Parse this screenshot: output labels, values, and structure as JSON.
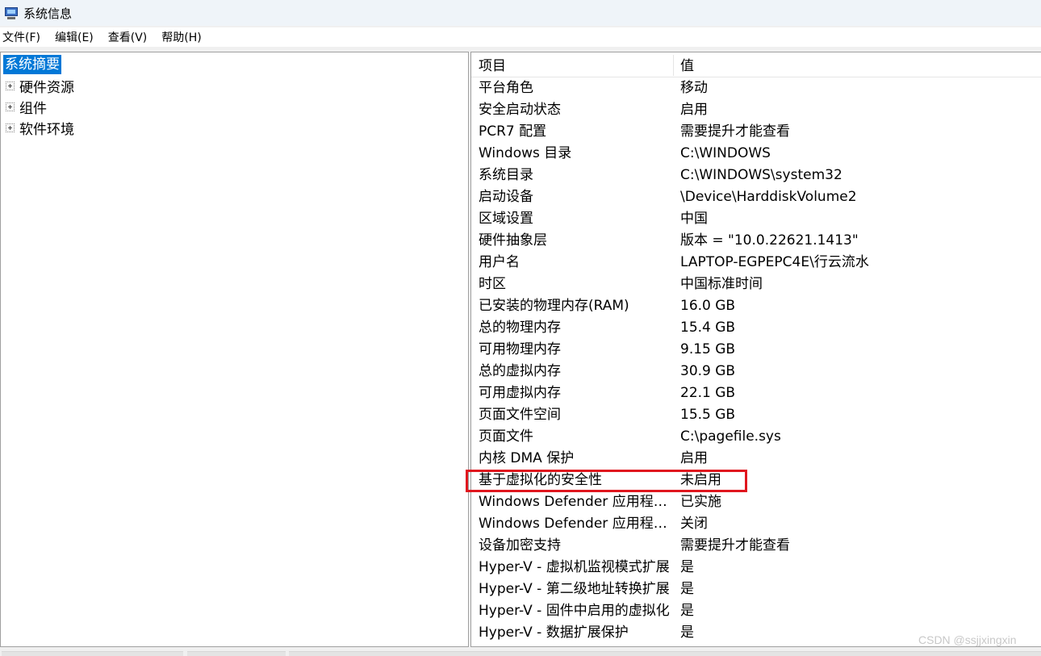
{
  "window": {
    "title": "系统信息",
    "icon": "system-info-icon"
  },
  "menu": [
    {
      "label": "文件(F)"
    },
    {
      "label": "编辑(E)"
    },
    {
      "label": "查看(V)"
    },
    {
      "label": "帮助(H)"
    }
  ],
  "tree": {
    "root": "系统摘要",
    "children": [
      {
        "label": "硬件资源"
      },
      {
        "label": "组件"
      },
      {
        "label": "软件环境"
      }
    ]
  },
  "table": {
    "headers": {
      "item": "项目",
      "value": "值"
    },
    "rows": [
      {
        "item": "平台角色",
        "value": "移动"
      },
      {
        "item": "安全启动状态",
        "value": "启用"
      },
      {
        "item": "PCR7 配置",
        "value": "需要提升才能查看"
      },
      {
        "item": "Windows 目录",
        "value": "C:\\WINDOWS"
      },
      {
        "item": "系统目录",
        "value": "C:\\WINDOWS\\system32"
      },
      {
        "item": "启动设备",
        "value": "\\Device\\HarddiskVolume2"
      },
      {
        "item": "区域设置",
        "value": "中国"
      },
      {
        "item": "硬件抽象层",
        "value": "版本 = \"10.0.22621.1413\""
      },
      {
        "item": "用户名",
        "value": "LAPTOP-EGPEPC4E\\行云流水"
      },
      {
        "item": "时区",
        "value": "中国标准时间"
      },
      {
        "item": "已安装的物理内存(RAM)",
        "value": "16.0 GB"
      },
      {
        "item": "总的物理内存",
        "value": "15.4 GB"
      },
      {
        "item": "可用物理内存",
        "value": "9.15 GB"
      },
      {
        "item": "总的虚拟内存",
        "value": "30.9 GB"
      },
      {
        "item": "可用虚拟内存",
        "value": "22.1 GB"
      },
      {
        "item": "页面文件空间",
        "value": "15.5 GB"
      },
      {
        "item": "页面文件",
        "value": "C:\\pagefile.sys"
      },
      {
        "item": "内核 DMA 保护",
        "value": "启用"
      },
      {
        "item": "基于虚拟化的安全性",
        "value": "未启用"
      },
      {
        "item": "Windows Defender 应用程序...",
        "value": "已实施"
      },
      {
        "item": "Windows Defender 应用程序...",
        "value": "关闭"
      },
      {
        "item": "设备加密支持",
        "value": "需要提升才能查看"
      },
      {
        "item": "Hyper-V - 虚拟机监视模式扩展",
        "value": "是"
      },
      {
        "item": "Hyper-V - 第二级地址转换扩展",
        "value": "是"
      },
      {
        "item": "Hyper-V - 固件中启用的虚拟化",
        "value": "是"
      },
      {
        "item": "Hyper-V - 数据扩展保护",
        "value": "是"
      }
    ]
  },
  "annotation": {
    "highlighted_row": "基于虚拟化的安全性",
    "color": "#e0161e"
  },
  "watermark": "CSDN @ssjjxingxin",
  "colors": {
    "selection": "#0078d7",
    "titlebar": "#eff4f9"
  }
}
